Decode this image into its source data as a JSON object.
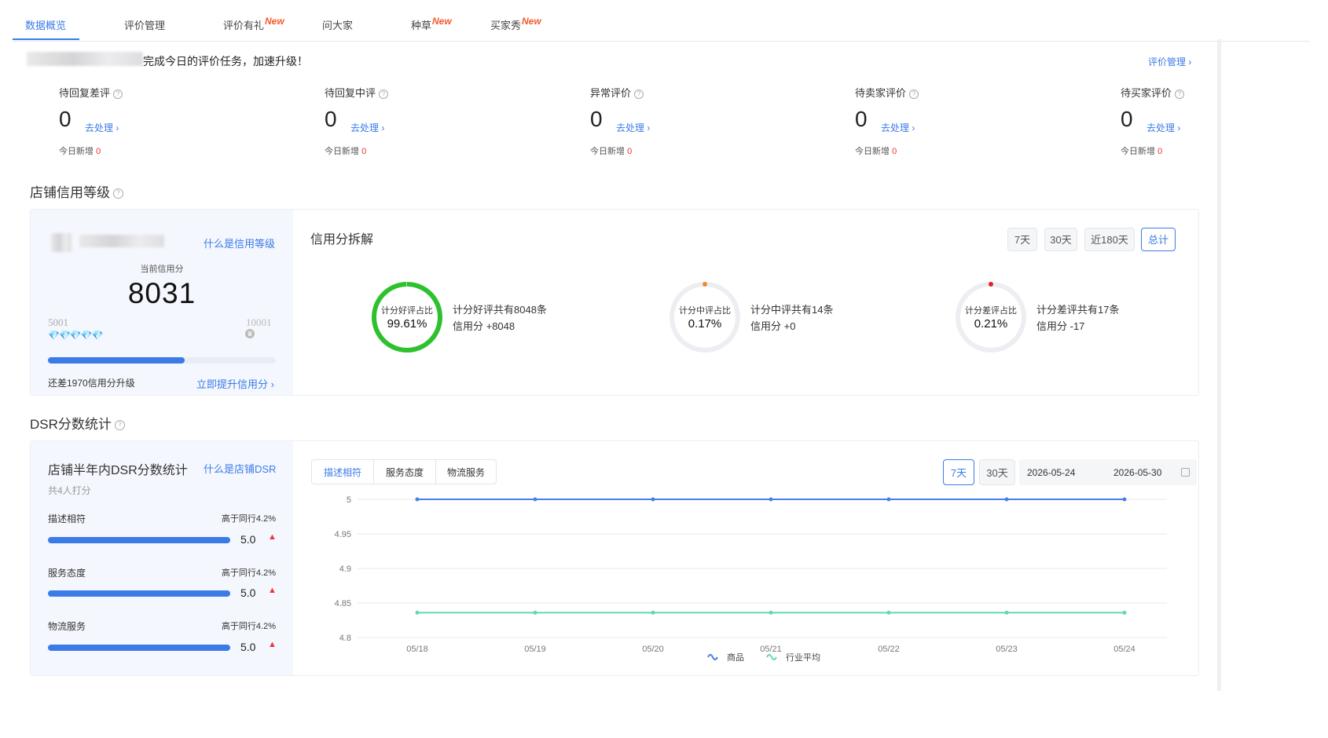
{
  "tabs": [
    {
      "label": "数据概览",
      "new": ""
    },
    {
      "label": "评价管理",
      "new": ""
    },
    {
      "label": "评价有礼",
      "new": "New"
    },
    {
      "label": "问大家",
      "new": ""
    },
    {
      "label": "种草",
      "new": "New"
    },
    {
      "label": "买家秀",
      "new": "New"
    }
  ],
  "banner": {
    "text": "完成今日的评价任务，加速升级！",
    "link": "评价管理 ›"
  },
  "stats": [
    {
      "label": "待回复差评",
      "value": "0",
      "go": "去处理 ›",
      "new_label": "今日新增",
      "new_value": "0"
    },
    {
      "label": "待回复中评",
      "value": "0",
      "go": "去处理 ›",
      "new_label": "今日新增",
      "new_value": "0"
    },
    {
      "label": "异常评价",
      "value": "0",
      "go": "去处理 ›",
      "new_label": "今日新增",
      "new_value": "0"
    },
    {
      "label": "待卖家评价",
      "value": "0",
      "go": "去处理 ›",
      "new_label": "今日新增",
      "new_value": "0"
    },
    {
      "label": "待买家评价",
      "value": "0",
      "go": "去处理 ›",
      "new_label": "今日新增",
      "new_value": "0"
    }
  ],
  "credit": {
    "section_title": "店铺信用等级",
    "what_link": "什么是信用等级",
    "current_label": "当前信用分",
    "score": "8031",
    "range_low": "5001",
    "range_high": "10001",
    "progress": 0.6,
    "gap_text": "还差1970信用分升级",
    "boost_link": "立即提升信用分 ›",
    "breakdown_title": "信用分拆解",
    "periods": [
      "7天",
      "30天",
      "近180天",
      "总计"
    ],
    "active_period": "总计",
    "circles": [
      {
        "label": "计分好评占比",
        "pct": "99.61%",
        "fraction": 0.9961,
        "color": "#2ec12e",
        "dot": "",
        "desc": "计分好评共有8048条",
        "score": "信用分 +8048"
      },
      {
        "label": "计分中评占比",
        "pct": "0.17%",
        "fraction": 0.0017,
        "color": "#f5892a",
        "dot": "#f5892a",
        "desc": "计分中评共有14条",
        "score": "信用分 +0"
      },
      {
        "label": "计分差评占比",
        "pct": "0.21%",
        "fraction": 0.0021,
        "color": "#e52222",
        "dot": "#e52222",
        "desc": "计分差评共有17条",
        "score": "信用分 -17"
      }
    ]
  },
  "dsr": {
    "section_title": "DSR分数统计",
    "panel_title": "店铺半年内DSR分数统计",
    "what_link": "什么是店铺DSR",
    "raters": "共4人打分",
    "items": [
      {
        "label": "描述相符",
        "compare": "高于同行4.2%",
        "score": "5.0",
        "fill": 1.0
      },
      {
        "label": "服务态度",
        "compare": "高于同行4.2%",
        "score": "5.0",
        "fill": 1.0
      },
      {
        "label": "物流服务",
        "compare": "高于同行4.2%",
        "score": "5.0",
        "fill": 1.0
      }
    ],
    "segments": [
      "描述相符",
      "服务态度",
      "物流服务"
    ],
    "periods": [
      "7天",
      "30天"
    ],
    "active_period": "7天",
    "date_start": "2026-05-24",
    "date_end": "2026-05-30"
  },
  "chart_data": {
    "type": "line",
    "x": [
      "05/18",
      "05/19",
      "05/20",
      "05/21",
      "05/22",
      "05/23",
      "05/24"
    ],
    "yticks": [
      "5",
      "4.95",
      "4.9",
      "4.85",
      "4.8"
    ],
    "ylim": [
      4.8,
      5
    ],
    "series": [
      {
        "name": "商品",
        "color": "#4a7fe8",
        "values": [
          5,
          5,
          5,
          5,
          5,
          5,
          5
        ]
      },
      {
        "name": "行业平均",
        "color": "#5fd8b8",
        "values": [
          4.836,
          4.836,
          4.836,
          4.836,
          4.836,
          4.836,
          4.836
        ]
      }
    ],
    "legend": "bottom",
    "grid": true
  }
}
